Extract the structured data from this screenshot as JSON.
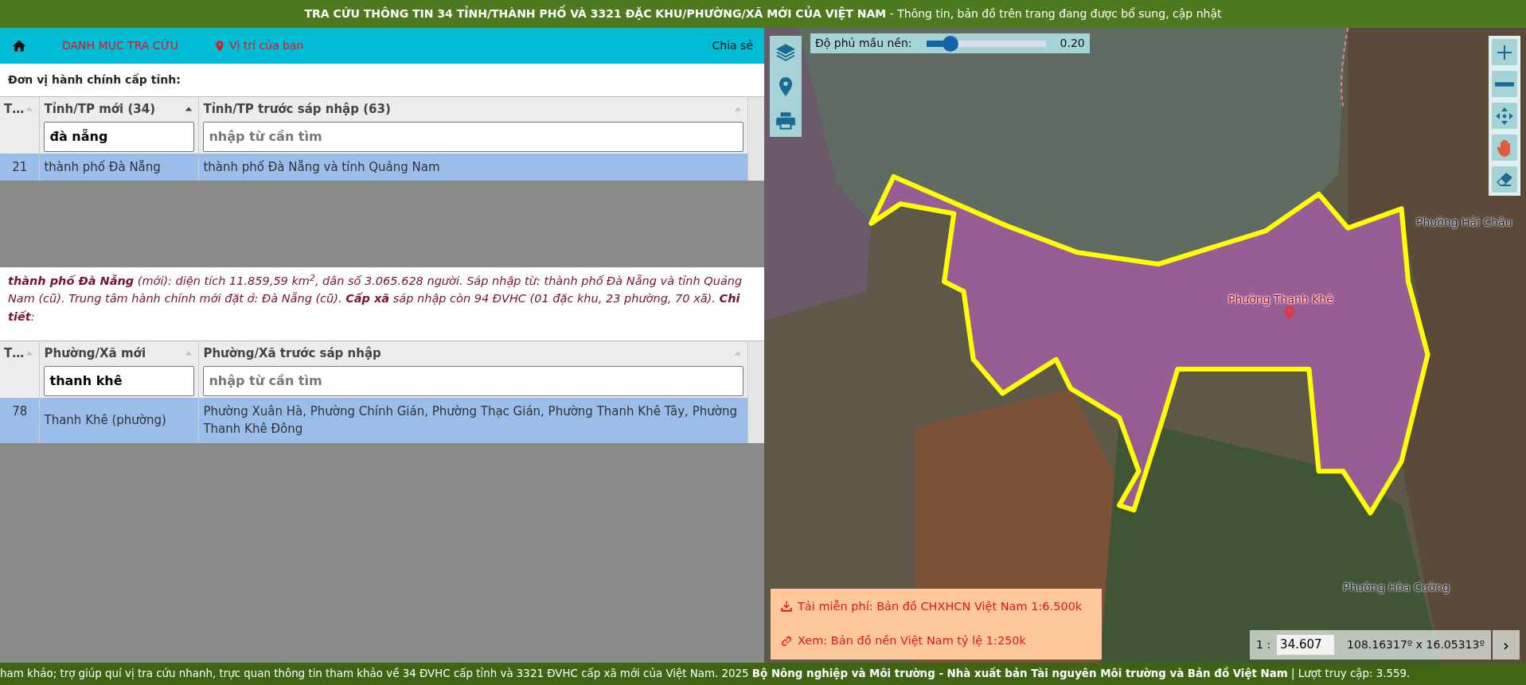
{
  "header": {
    "title": "**TRA CỨU THÔNG TIN 34 TỈNH/THÀNH PHỐ VÀ 3321 ĐẶC KHU/PHƯỜNG/XÃ MỚI CỦA VIỆT NAM** - Thông tin, bản đồ trên trang đang được bổ sung, cập nhật"
  },
  "nav": {
    "items": [
      {
        "kind": "home"
      },
      {
        "kind": "link",
        "label": "DANH MỤC TRA CỨU"
      },
      {
        "kind": "location",
        "label": "Vị trí của bạn"
      }
    ],
    "share": "Chia sẻ"
  },
  "province_table": {
    "title": "Đơn vị hành chính cấp tỉnh:",
    "columns": [
      {
        "label": "T…",
        "sorted": false
      },
      {
        "label": "Tỉnh/TP mới (34)",
        "sorted": true
      },
      {
        "label": "Tỉnh/TP trước sáp nhập (63)",
        "sorted": false
      }
    ],
    "filters": [
      {
        "value": "đà nẵng"
      },
      {
        "placeholder": "nhập từ cần tìm"
      }
    ],
    "rows": [
      {
        "cells": [
          "21",
          "thành phố Đà Nẵng",
          "thành phố Đà Nẵng và tỉnh Quảng Nam"
        ],
        "selected": true
      }
    ]
  },
  "summary": "**thành phố Đà Nẵng** (mới): diện tích 11.859,59 km$^{2}$, dân số 3.065.628 người. Sáp nhập từ: thành phố Đà Nẵng và tỉnh Quảng Nam (cũ). Trung tâm hành chính mới đặt ở: Đà Nẵng (cũ). **Cấp xã** sáp nhập còn 94 ĐVHC (01 đặc khu, 23 phường, 70 xã). **Chi tiết**:",
  "ward_table": {
    "columns": [
      {
        "label": "T…",
        "sorted": false
      },
      {
        "label": "Phường/Xã mới",
        "sorted": false
      },
      {
        "label": "Phường/Xã trước sáp nhập",
        "sorted": false
      }
    ],
    "filters": [
      {
        "value": "thanh khê"
      },
      {
        "placeholder": "nhập từ cần tìm"
      }
    ],
    "rows": [
      {
        "cells": [
          "78",
          "Thanh Khê (phường)",
          "Phường Xuân Hà, Phường Chính Gián, Phường Thạc Gián, Phường Thanh Khê Tây, Phường Thanh Khê Đông"
        ],
        "selected": true
      }
    ]
  },
  "map": {
    "opacity_slider": {
      "label": "Độ phủ mầu nền:",
      "level": 0.2,
      "reading": "0.20"
    },
    "left_tools": [
      {
        "kind": "layers"
      },
      {
        "kind": "pin"
      },
      {
        "kind": "print"
      }
    ],
    "right_tools": [
      {
        "kind": "zoom-in"
      },
      {
        "kind": "zoom-out"
      },
      {
        "kind": "pan"
      },
      {
        "kind": "hand"
      },
      {
        "kind": "eraser"
      }
    ],
    "labels": [
      {
        "text": "Phường Hải Châu",
        "kind": "area"
      },
      {
        "text": "Phường Thanh Khê",
        "kind": "selected"
      },
      {
        "text": "Phường Hòa Cường",
        "kind": "area"
      }
    ],
    "links": [
      {
        "kind": "download",
        "label": "Tải miễn phí: Bản đồ CHXHCN Việt Nam 1:6.500k"
      },
      {
        "kind": "link",
        "label": "Xem: Bản đồ nền Việt Nam tỷ lệ 1:250k"
      }
    ],
    "scale": {
      "prefix": "1 :",
      "value": "34.607",
      "coords": "108.16317º x 16.05313º",
      "next": "›"
    }
  },
  "footer": {
    "text": "ham khảo; trợ giúp quí vị tra cứu nhanh, trực quan thông tin tham khảo về 34 ĐVHC cấp tỉnh và 3321 ĐVHC cấp xã mới của Việt Nam. 2025  **Bộ Nông nghiệp và Môi trường - Nhà xuất bản Tài nguyên Môi trường và Bản đồ Việt Nam** | Lượt truy cập: 3.559."
  }
}
